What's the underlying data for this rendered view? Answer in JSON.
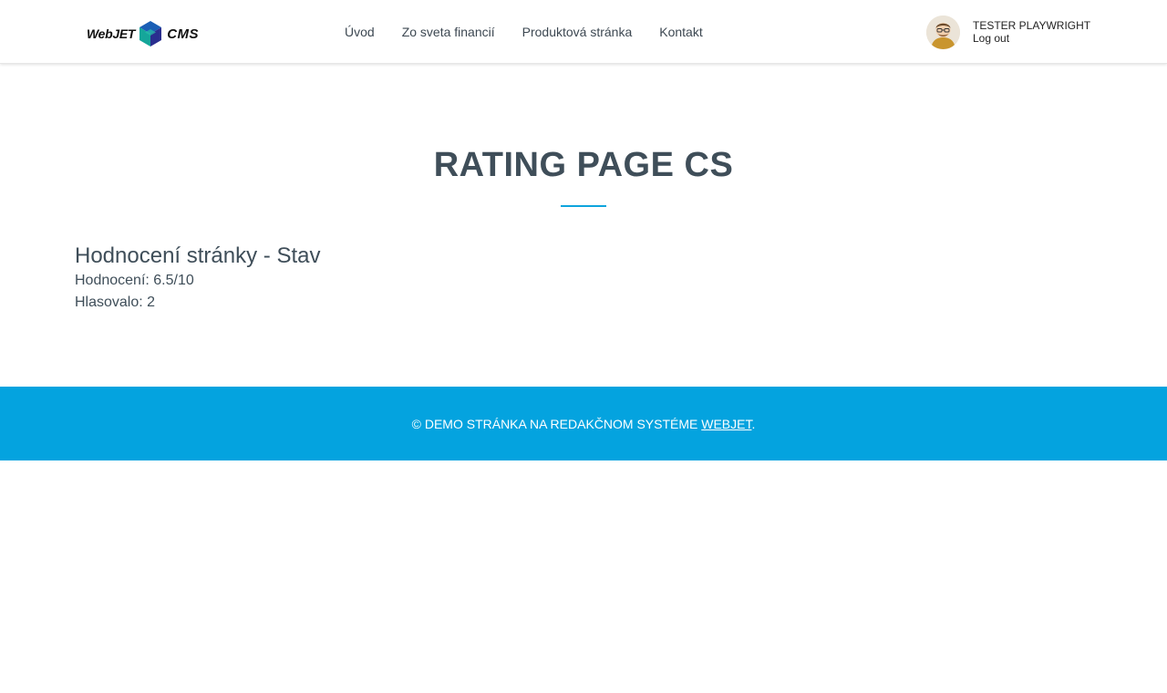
{
  "header": {
    "logo": {
      "left_text": "WebJET",
      "right_text": "CMS"
    },
    "nav": [
      {
        "label": "Úvod"
      },
      {
        "label": "Zo sveta financií"
      },
      {
        "label": "Produktová stránka"
      },
      {
        "label": "Kontakt"
      }
    ],
    "user": {
      "name": "TESTER PLAYWRIGHT",
      "logout_label": "Log out"
    }
  },
  "main": {
    "title": "RATING PAGE CS",
    "rating": {
      "heading": "Hodnocení stránky - Stav",
      "score_line": "Hodnocení: 6.5/10",
      "votes_line": "Hlasovalo: 2"
    }
  },
  "footer": {
    "text": "© DEMO STRÁNKA NA REDAKČNOM SYSTÉME ",
    "link_label": "WEBJET",
    "suffix": "."
  },
  "colors": {
    "accent": "#04a3df",
    "text": "#3f4e59"
  }
}
